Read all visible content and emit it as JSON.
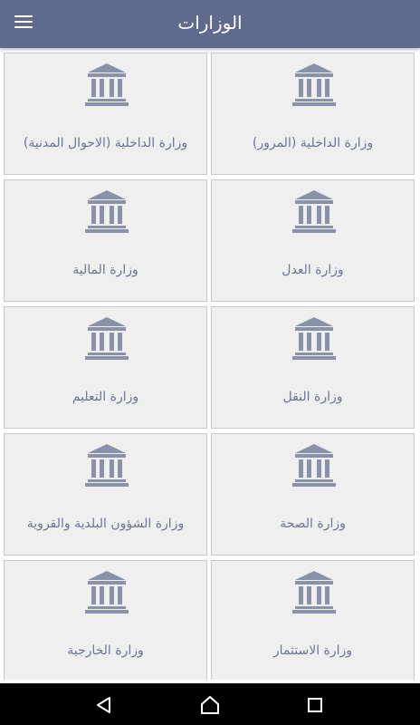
{
  "header": {
    "title": "الوزارات",
    "menu_icon": "hamburger-menu-icon"
  },
  "ministries": [
    {
      "label": "وزارة الداخلية (المرور)",
      "icon": "bank-building-icon"
    },
    {
      "label": "وزارة الداخلية (الاحوال المدنية)",
      "icon": "bank-building-icon"
    },
    {
      "label": "وزارة العدل",
      "icon": "bank-building-icon"
    },
    {
      "label": "وزارة المالية",
      "icon": "bank-building-icon"
    },
    {
      "label": "وزارة النقل",
      "icon": "bank-building-icon"
    },
    {
      "label": "وزارة التعليم",
      "icon": "bank-building-icon"
    },
    {
      "label": "وزارة الصحة",
      "icon": "bank-building-icon"
    },
    {
      "label": "وزارة الشؤون البلدية والقروية",
      "icon": "bank-building-icon"
    },
    {
      "label": "وزارة الاستثمار",
      "icon": "bank-building-icon"
    },
    {
      "label": "وزارة الخارجية",
      "icon": "bank-building-icon"
    }
  ],
  "system_nav": {
    "back_icon": "back-triangle-icon",
    "home_icon": "home-icon",
    "recents_icon": "recents-square-icon"
  },
  "colors": {
    "header": "#5f6b8c",
    "card": "#efefef",
    "icon": "#8a92aa",
    "label": "#6c7590"
  }
}
